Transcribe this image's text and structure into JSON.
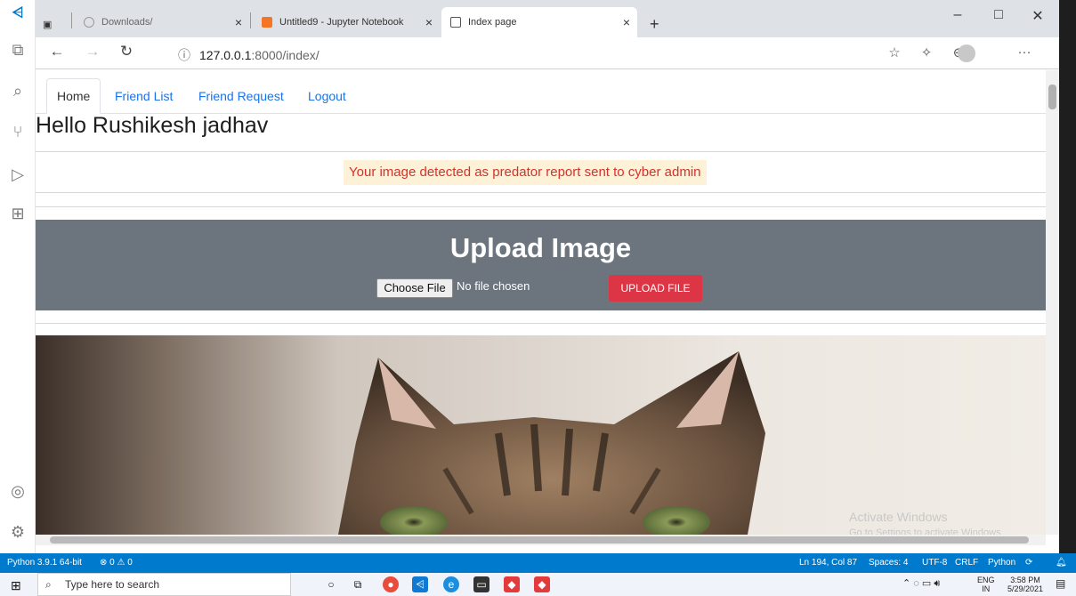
{
  "browser": {
    "tabs": [
      {
        "label": "Downloads/"
      },
      {
        "label": "Untitled9 - Jupyter Notebook"
      },
      {
        "label": "Index page"
      }
    ],
    "new_tab_label": "+",
    "window_controls": {
      "minimize": "–",
      "maximize": "□",
      "close": "✕"
    },
    "url_host": "127.0.0.1",
    "url_rest": ":8000/index/",
    "more_label": "···"
  },
  "page": {
    "nav_tabs": [
      "Home",
      "Friend List",
      "Friend Request",
      "Logout"
    ],
    "greeting": "Hello Rushikesh jadhav",
    "alert": "Your image detected as predator report sent to cyber admin",
    "upload": {
      "title": "Upload Image",
      "choose_file": "Choose File",
      "no_file": "No file chosen",
      "submit": "UPLOAD FILE"
    }
  },
  "watermark": {
    "line1": "Activate Windows",
    "line2": "Go to Settings to activate Windows."
  },
  "statusbar": {
    "python": "Python 3.9.1 64-bit",
    "problems": "⊗ 0 ⚠ 0",
    "position": "Ln 194, Col 87",
    "spaces": "Spaces: 4",
    "encoding": "UTF-8",
    "eol": "CRLF",
    "language": "Python"
  },
  "taskbar": {
    "search_placeholder": "Type here to search",
    "lang_top": "ENG",
    "lang_bottom": "IN",
    "time": "3:58 PM",
    "date": "5/29/2021"
  },
  "colors": {
    "alert_text": "#d6312b",
    "upload_bg": "#6c757d",
    "upload_btn": "#dc3545",
    "link": "#1a73e8",
    "statusbar": "#007acc"
  }
}
